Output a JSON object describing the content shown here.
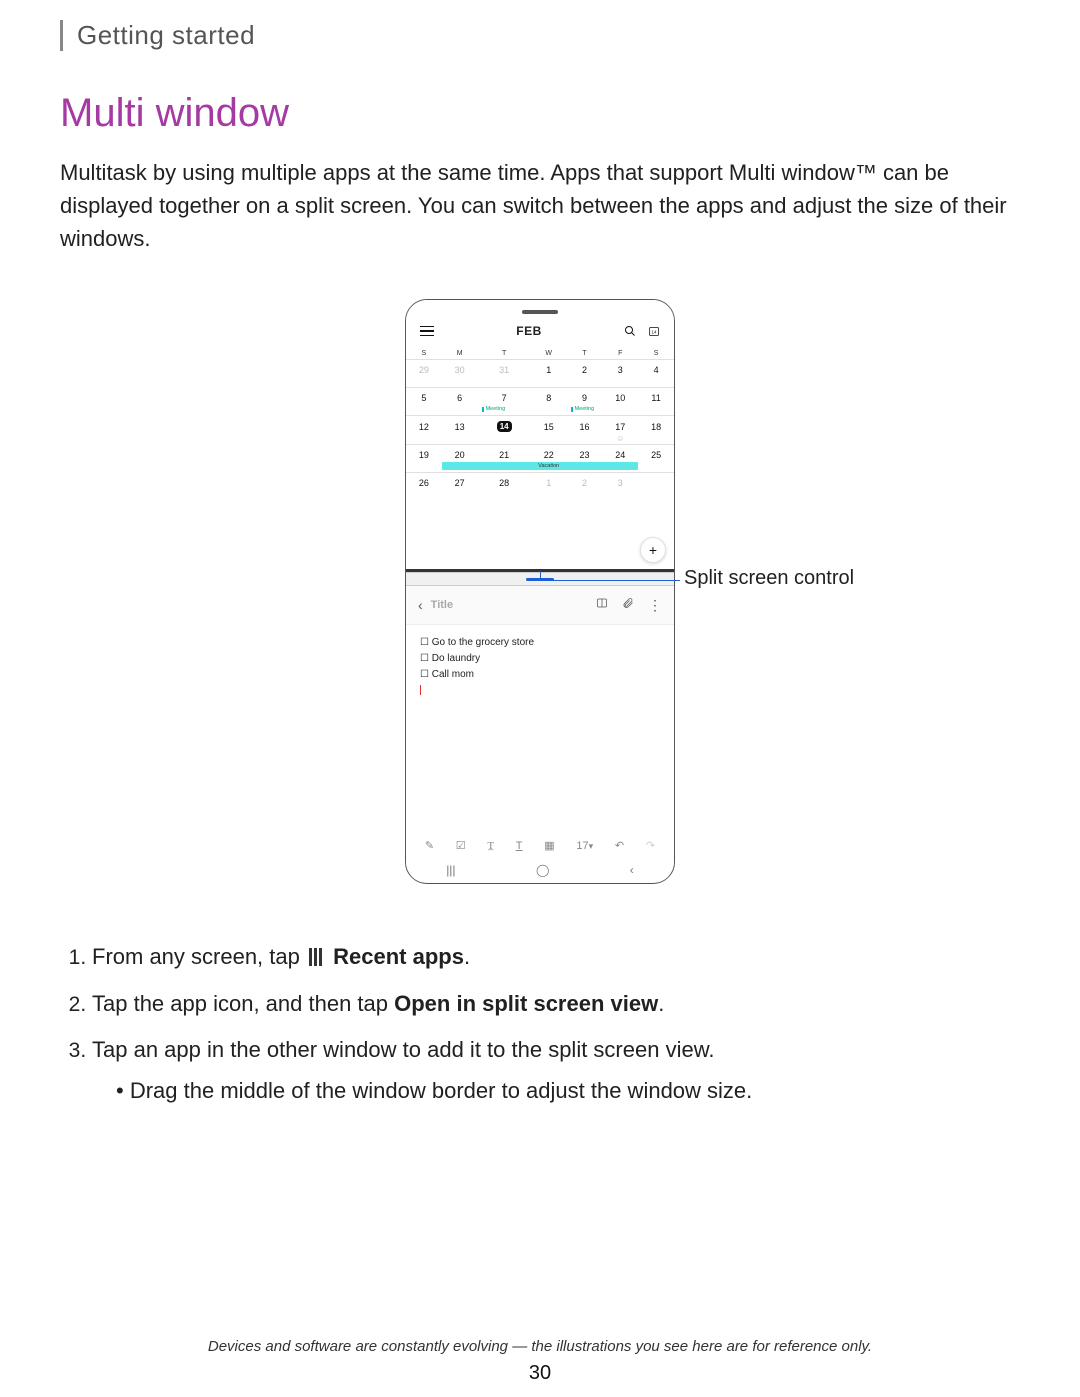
{
  "header": {
    "section": "Getting started"
  },
  "title": "Multi window",
  "intro": "Multitask by using multiple apps at the same time. Apps that support Multi window™ can be displayed together on a split screen. You can switch between the apps and adjust the size of their windows.",
  "callouts": {
    "split_control": "Split screen control"
  },
  "calendar": {
    "month_label": "FEB",
    "daycols": [
      "S",
      "M",
      "T",
      "W",
      "T",
      "F",
      "S"
    ],
    "rows": [
      [
        {
          "d": "29",
          "cls": "prev"
        },
        {
          "d": "30",
          "cls": "prev"
        },
        {
          "d": "31",
          "cls": "prev"
        },
        {
          "d": "1"
        },
        {
          "d": "2"
        },
        {
          "d": "3"
        },
        {
          "d": "4"
        }
      ],
      [
        {
          "d": "5"
        },
        {
          "d": "6"
        },
        {
          "d": "7",
          "evt": "Meeting"
        },
        {
          "d": "8"
        },
        {
          "d": "9",
          "evt": "Meeting"
        },
        {
          "d": "10"
        },
        {
          "d": "11"
        }
      ],
      [
        {
          "d": "12"
        },
        {
          "d": "13"
        },
        {
          "d": "14",
          "cls": "today"
        },
        {
          "d": "15"
        },
        {
          "d": "16"
        },
        {
          "d": "17",
          "smiley": true
        },
        {
          "d": "18"
        }
      ],
      [
        {
          "d": "19"
        },
        {
          "d": "20",
          "vac_start": true
        },
        {
          "d": "21"
        },
        {
          "d": "22",
          "vac_label": "Vacation"
        },
        {
          "d": "23"
        },
        {
          "d": "24",
          "vac_end": true
        },
        {
          "d": "25"
        }
      ],
      [
        {
          "d": "26"
        },
        {
          "d": "27"
        },
        {
          "d": "28"
        },
        {
          "d": "1",
          "cls": "next"
        },
        {
          "d": "2",
          "cls": "next"
        },
        {
          "d": "3",
          "cls": "next"
        },
        {
          "d": ""
        }
      ]
    ],
    "today_badge": "14"
  },
  "notes": {
    "title_placeholder": "Title",
    "items": [
      "Go to the grocery store",
      "Do laundry",
      "Call mom"
    ],
    "font_size_label": "17"
  },
  "steps": {
    "s1_a": "From any screen, tap",
    "s1_b": "Recent apps",
    "s2_a": "Tap the app icon, and then tap ",
    "s2_b": "Open in split screen view",
    "s3": "Tap an app in the other window to add it to the split screen view.",
    "s3_sub": "Drag the middle of the window border to adjust the window size."
  },
  "footer": {
    "note": "Devices and software are constantly evolving — the illustrations you see here are for reference only.",
    "page": "30"
  }
}
